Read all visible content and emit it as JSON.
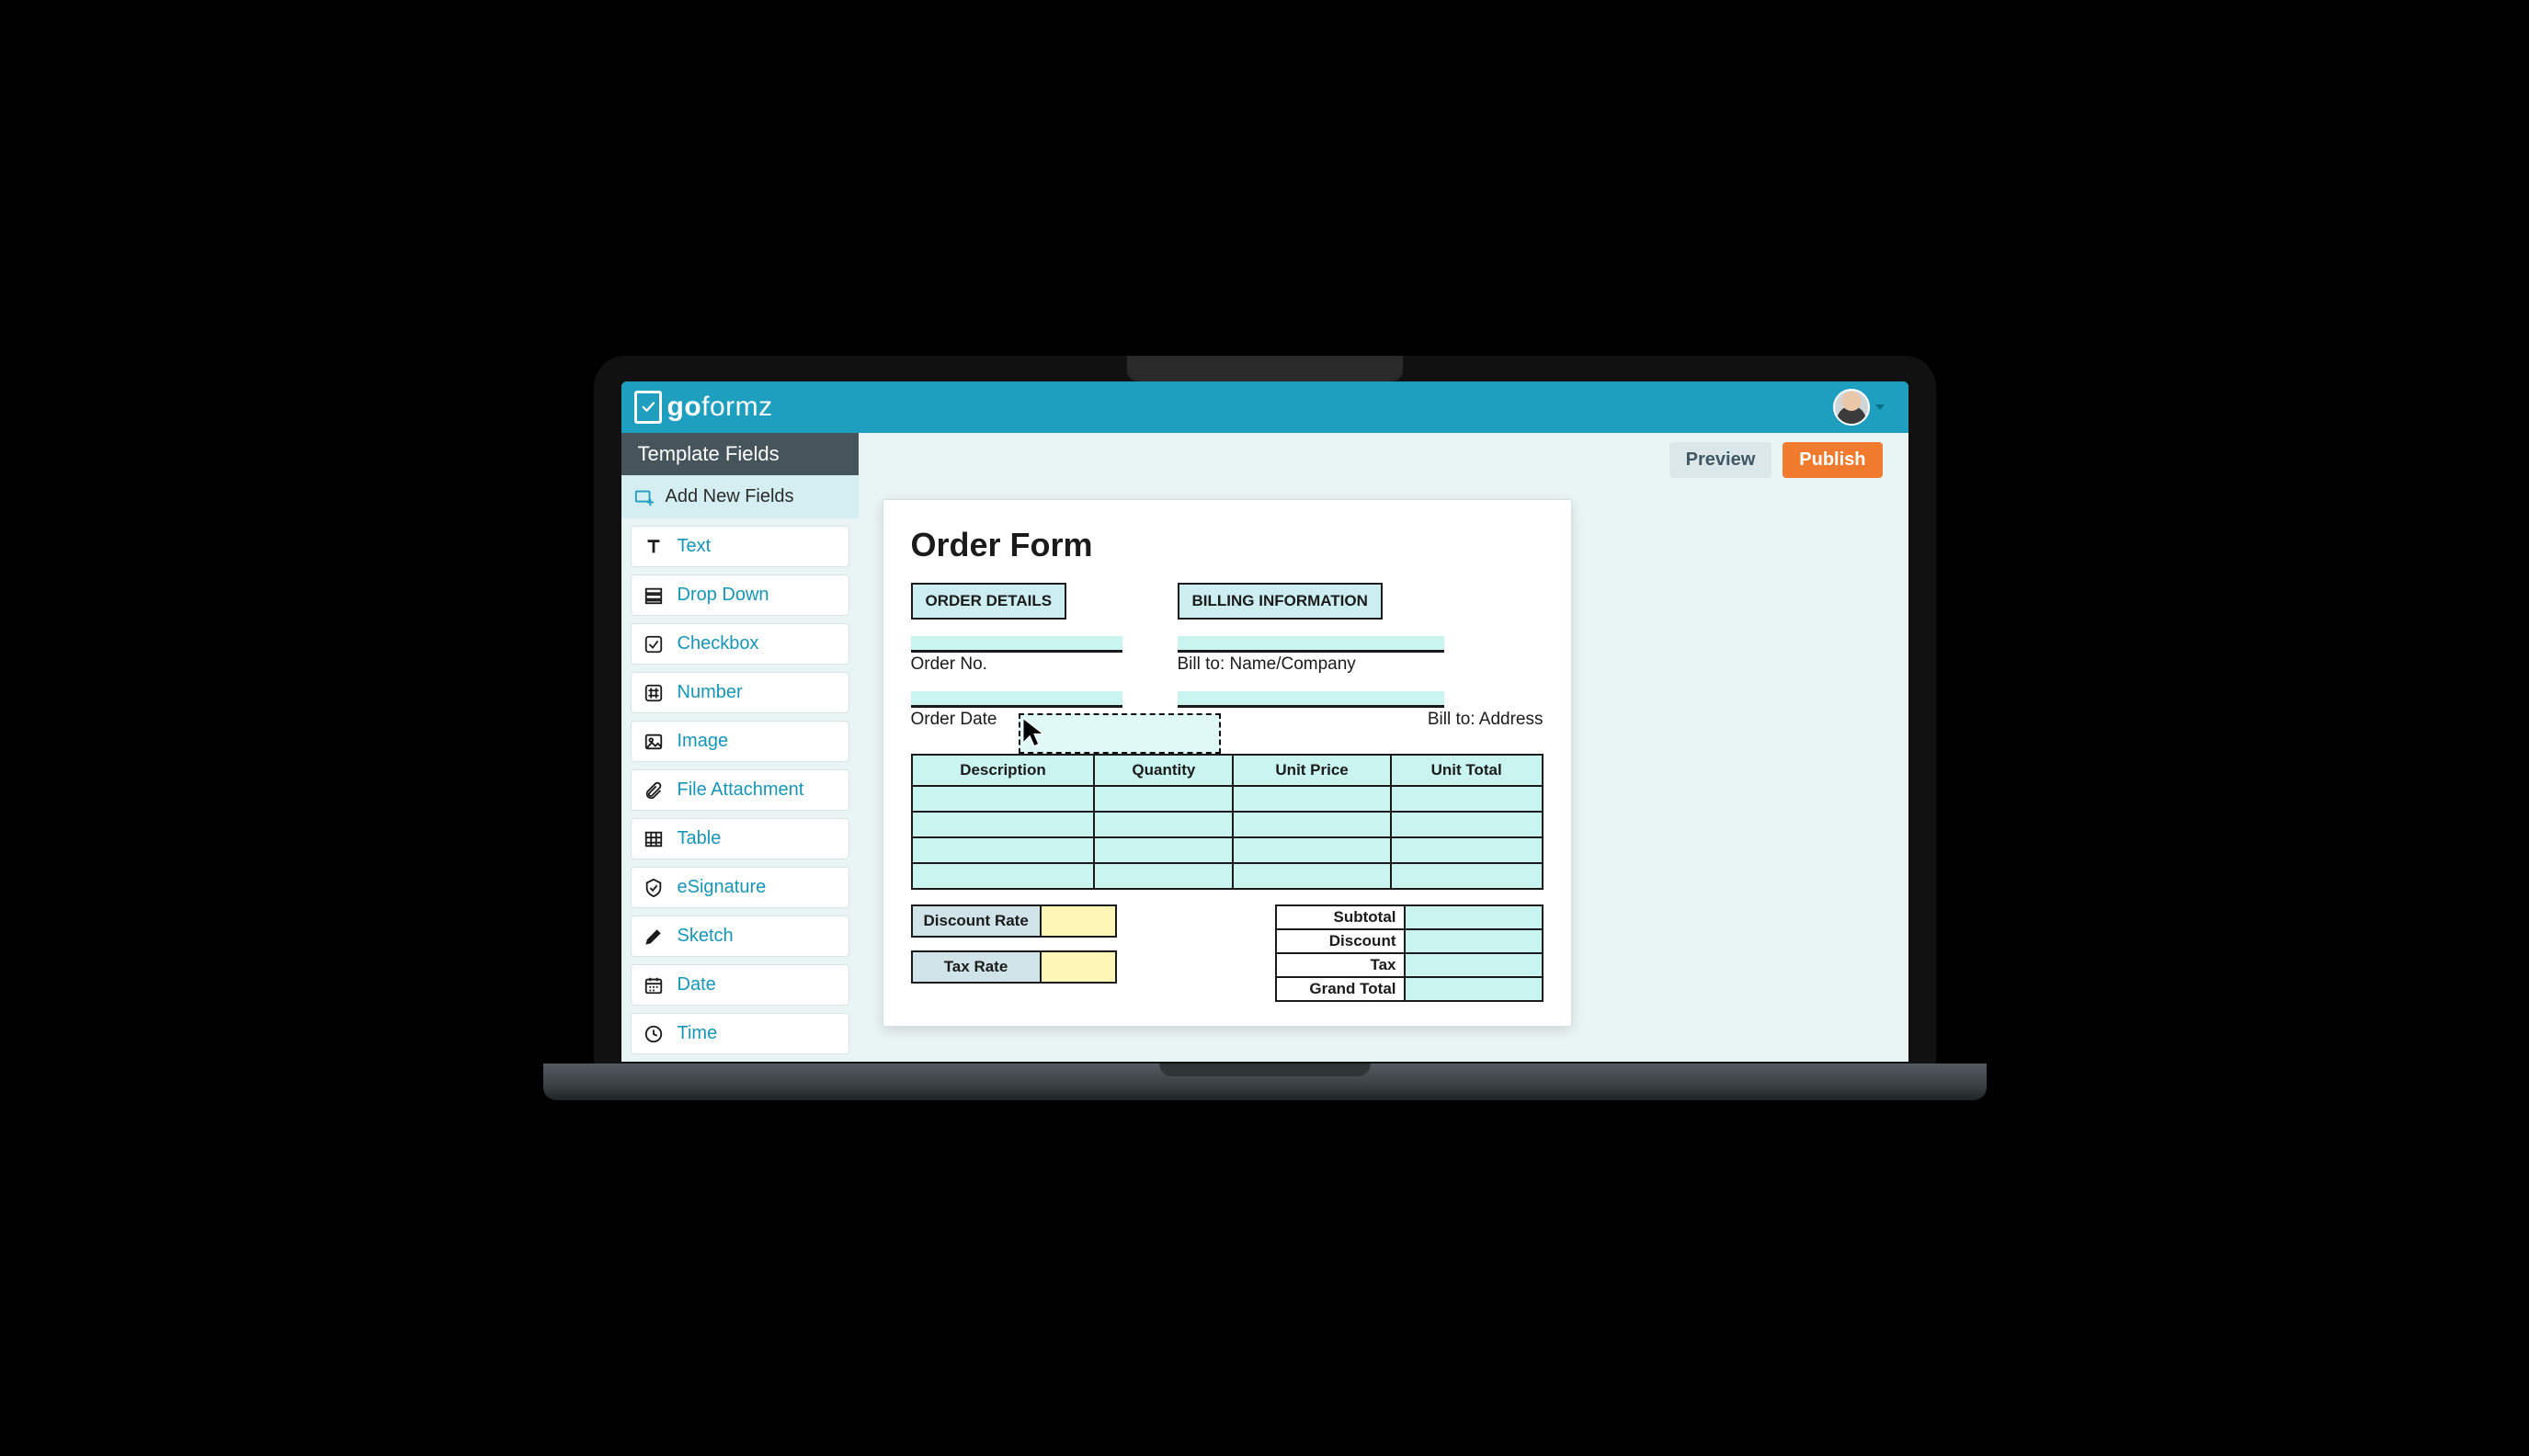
{
  "brand": {
    "name_bold": "go",
    "name_light": "formz"
  },
  "toolbar": {
    "preview": "Preview",
    "publish": "Publish"
  },
  "sidebar": {
    "title": "Template Fields",
    "add_label": "Add New Fields",
    "fields": [
      {
        "icon": "text",
        "label": "Text"
      },
      {
        "icon": "dropdown",
        "label": "Drop Down"
      },
      {
        "icon": "checkbox",
        "label": "Checkbox"
      },
      {
        "icon": "number",
        "label": "Number"
      },
      {
        "icon": "image",
        "label": "Image"
      },
      {
        "icon": "attachment",
        "label": "File Attachment"
      },
      {
        "icon": "table",
        "label": "Table"
      },
      {
        "icon": "esignature",
        "label": "eSignature"
      },
      {
        "icon": "sketch",
        "label": "Sketch"
      },
      {
        "icon": "date",
        "label": "Date"
      },
      {
        "icon": "time",
        "label": "Time"
      }
    ]
  },
  "form": {
    "title": "Order Form",
    "left_section": "ORDER DETAILS",
    "right_section": "BILLING INFORMATION",
    "order_no": "Order No.",
    "order_date": "Order Date",
    "bill_name": "Bill to: Name/Company",
    "bill_addr": "Bill to: Address",
    "table_headers": [
      "Description",
      "Quantity",
      "Unit Price",
      "Unit Total"
    ],
    "discount_rate": "Discount Rate",
    "tax_rate": "Tax Rate",
    "totals": [
      "Subtotal",
      "Discount",
      "Tax",
      "Grand Total"
    ]
  }
}
